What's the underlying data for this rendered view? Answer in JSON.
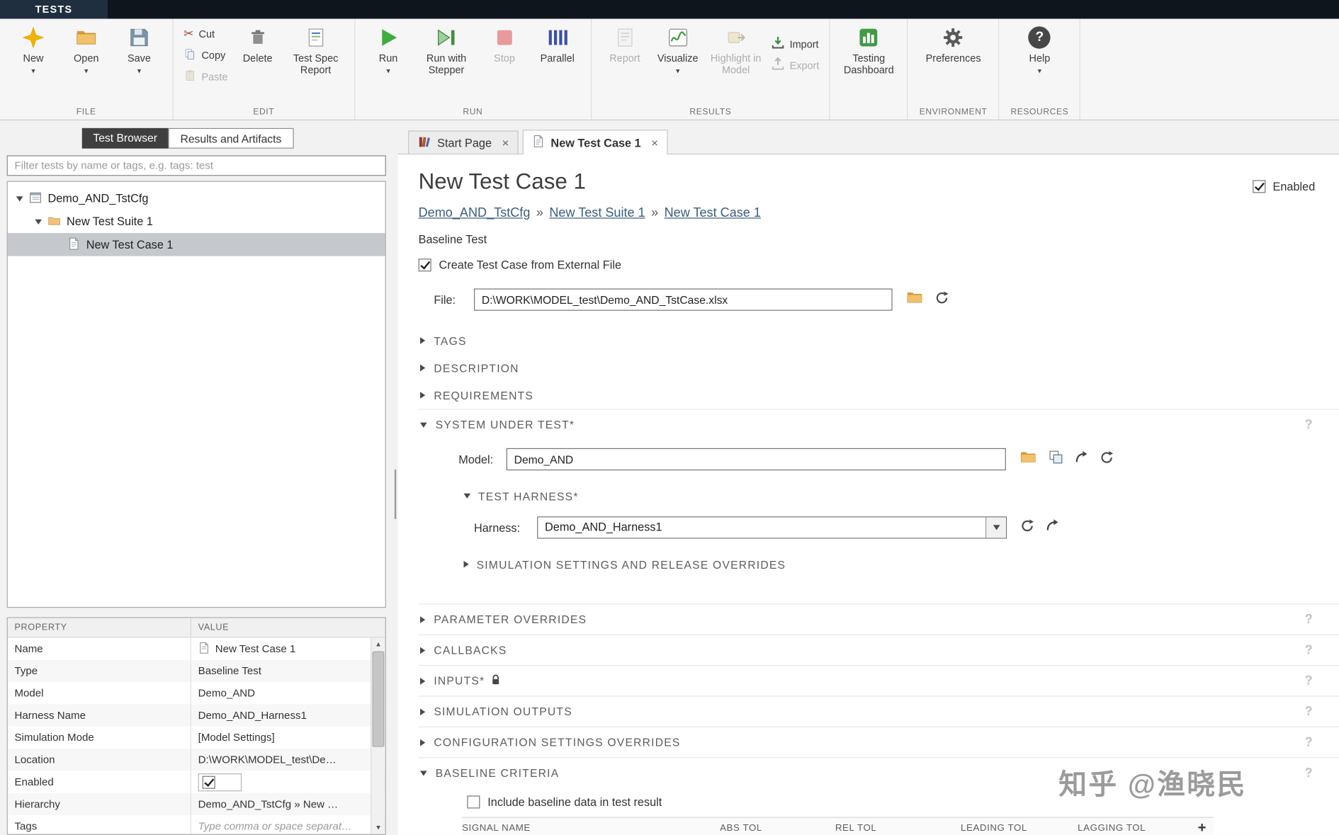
{
  "topbar": {
    "tests_tab": "TESTS"
  },
  "ribbon": {
    "file": {
      "label": "FILE",
      "new": "New",
      "open": "Open",
      "save": "Save"
    },
    "edit": {
      "label": "EDIT",
      "cut": "Cut",
      "copy": "Copy",
      "paste": "Paste",
      "delete": "Delete",
      "test_spec_report": "Test Spec Report"
    },
    "run": {
      "label": "RUN",
      "run": "Run",
      "run_with_stepper": "Run with Stepper",
      "stop": "Stop",
      "parallel": "Parallel"
    },
    "results": {
      "label": "RESULTS",
      "report": "Report",
      "visualize": "Visualize",
      "highlight_in_model": "Highlight in Model",
      "import": "Import",
      "export": "Export"
    },
    "dashboard": {
      "testing_dashboard": "Testing Dashboard"
    },
    "environment": {
      "label": "ENVIRONMENT",
      "preferences": "Preferences"
    },
    "resources": {
      "label": "RESOURCES",
      "help": "Help"
    }
  },
  "left_panel": {
    "tabs": {
      "test_browser": "Test Browser",
      "results_and_artifacts": "Results and Artifacts"
    },
    "filter_placeholder": "Filter tests by name or tags, e.g. tags: test",
    "tree": [
      {
        "label": "Demo_AND_TstCfg"
      },
      {
        "label": "New Test Suite 1"
      },
      {
        "label": "New Test Case 1"
      }
    ],
    "properties": {
      "col_property": "PROPERTY",
      "col_value": "VALUE",
      "rows": [
        {
          "p": "Name",
          "v": "New Test Case 1"
        },
        {
          "p": "Type",
          "v": "Baseline Test"
        },
        {
          "p": "Model",
          "v": "Demo_AND"
        },
        {
          "p": "Harness Name",
          "v": "Demo_AND_Harness1"
        },
        {
          "p": "Simulation Mode",
          "v": "[Model Settings]"
        },
        {
          "p": "Location",
          "v": "D:\\WORK\\MODEL_test\\De…"
        },
        {
          "p": "Enabled",
          "v": "",
          "checked": true
        },
        {
          "p": "Hierarchy",
          "v": "Demo_AND_TstCfg » New …"
        },
        {
          "p": "Tags",
          "v": "Type comma or space separat…"
        }
      ]
    }
  },
  "doc_tabs": {
    "start_page": "Start Page",
    "new_test_case": "New Test Case 1"
  },
  "main": {
    "title": "New Test Case 1",
    "enabled_label": "Enabled",
    "breadcrumb": [
      "Demo_AND_TstCfg",
      "New Test Suite 1",
      "New Test Case 1"
    ],
    "breadcrumb_separator": "»",
    "test_type": "Baseline Test",
    "create_from_external_label": "Create Test Case from External File",
    "file_label": "File:",
    "file_value": "D:\\WORK\\MODEL_test\\Demo_AND_TstCase.xlsx",
    "sections": {
      "tags": "TAGS",
      "description": "DESCRIPTION",
      "requirements": "REQUIREMENTS",
      "system_under_test": "SYSTEM UNDER TEST*",
      "test_harness": "TEST HARNESS*",
      "sim_settings": "SIMULATION SETTINGS AND RELEASE OVERRIDES",
      "parameter_overrides": "PARAMETER OVERRIDES",
      "callbacks": "CALLBACKS",
      "inputs": "INPUTS*",
      "simulation_outputs": "SIMULATION OUTPUTS",
      "config_overrides": "CONFIGURATION SETTINGS OVERRIDES",
      "baseline_criteria": "BASELINE CRITERIA"
    },
    "model_label": "Model:",
    "model_value": "Demo_AND",
    "harness_label": "Harness:",
    "harness_value": "Demo_AND_Harness1",
    "baseline": {
      "include_label": "Include baseline data in test result",
      "columns": [
        "SIGNAL NAME",
        "ABS TOL",
        "REL TOL",
        "LEADING TOL",
        "LAGGING TOL"
      ]
    },
    "watermark": "知乎 @渔晓民"
  }
}
